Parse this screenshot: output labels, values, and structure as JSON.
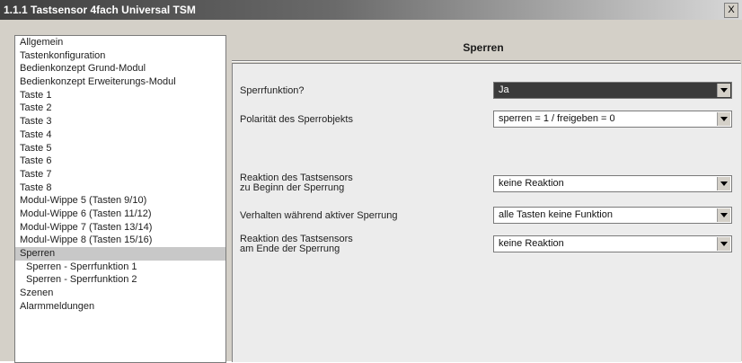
{
  "window": {
    "title": "1.1.1 Tastsensor 4fach Universal TSM",
    "close_label": "X"
  },
  "sidebar": {
    "items": [
      {
        "label": "Allgemein"
      },
      {
        "label": "Tastenkonfiguration"
      },
      {
        "label": "Bedienkonzept Grund-Modul"
      },
      {
        "label": "Bedienkonzept Erweiterungs-Modul"
      },
      {
        "label": "Taste 1"
      },
      {
        "label": "Taste 2"
      },
      {
        "label": "Taste 3"
      },
      {
        "label": "Taste 4"
      },
      {
        "label": "Taste 5"
      },
      {
        "label": "Taste 6"
      },
      {
        "label": "Taste 7"
      },
      {
        "label": "Taste 8"
      },
      {
        "label": "Modul-Wippe 5 (Tasten 9/10)"
      },
      {
        "label": "Modul-Wippe 6 (Tasten 11/12)"
      },
      {
        "label": "Modul-Wippe 7 (Tasten 13/14)"
      },
      {
        "label": "Modul-Wippe 8 (Tasten 15/16)"
      },
      {
        "label": "Sperren"
      },
      {
        "label": "Sperren - Sperrfunktion 1"
      },
      {
        "label": "Sperren - Sperrfunktion 2"
      },
      {
        "label": "Szenen"
      },
      {
        "label": "Alarmmeldungen"
      }
    ]
  },
  "panel": {
    "title": "Sperren",
    "params": [
      {
        "label_line1": "Sperrfunktion?",
        "label_line2": "",
        "value": "Ja"
      },
      {
        "label_line1": "Polarität des Sperrobjekts",
        "label_line2": "",
        "value": "sperren = 1 / freigeben = 0"
      },
      {
        "label_line1": "Reaktion des Tastsensors",
        "label_line2": "zu Beginn der Sperrung",
        "value": "keine Reaktion"
      },
      {
        "label_line1": "Verhalten während aktiver Sperrung",
        "label_line2": "",
        "value": "alle Tasten keine Funktion"
      },
      {
        "label_line1": "Reaktion des Tastsensors",
        "label_line2": "am Ende der Sperrung",
        "value": "keine Reaktion"
      }
    ]
  }
}
